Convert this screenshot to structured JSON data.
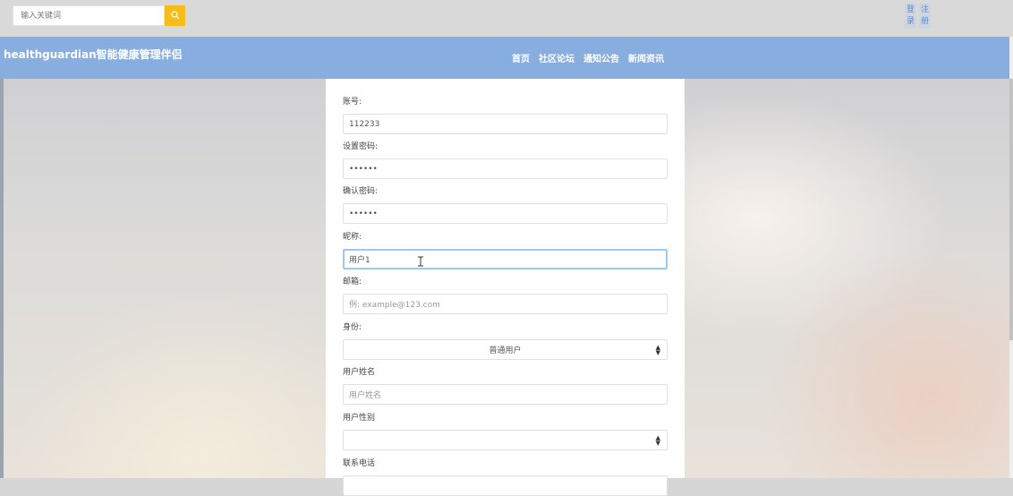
{
  "header": {
    "search": {
      "placeholder": "输入关键词"
    },
    "auth": {
      "login": "登录",
      "register": "注册"
    }
  },
  "navbar": {
    "brand": "healthguardian智能健康管理伴侣",
    "items": [
      "首页",
      "社区论坛",
      "通知公告",
      "新闻资讯"
    ]
  },
  "form": {
    "account": {
      "label": "账号:",
      "value": "112233"
    },
    "password": {
      "label": "设置密码:",
      "value": "••••••"
    },
    "confirm": {
      "label": "确认密码:",
      "value": "••••••"
    },
    "nickname": {
      "label": "昵称:",
      "value": "用户1"
    },
    "email": {
      "label": "邮箱:",
      "placeholder": "例: example@123.com"
    },
    "identity": {
      "label": "身份:",
      "value": "普通用户"
    },
    "realname": {
      "label": "用户姓名",
      "placeholder": "用户姓名"
    },
    "gender": {
      "label": "用户性别",
      "value": ""
    },
    "phone": {
      "label": "联系电话"
    }
  }
}
